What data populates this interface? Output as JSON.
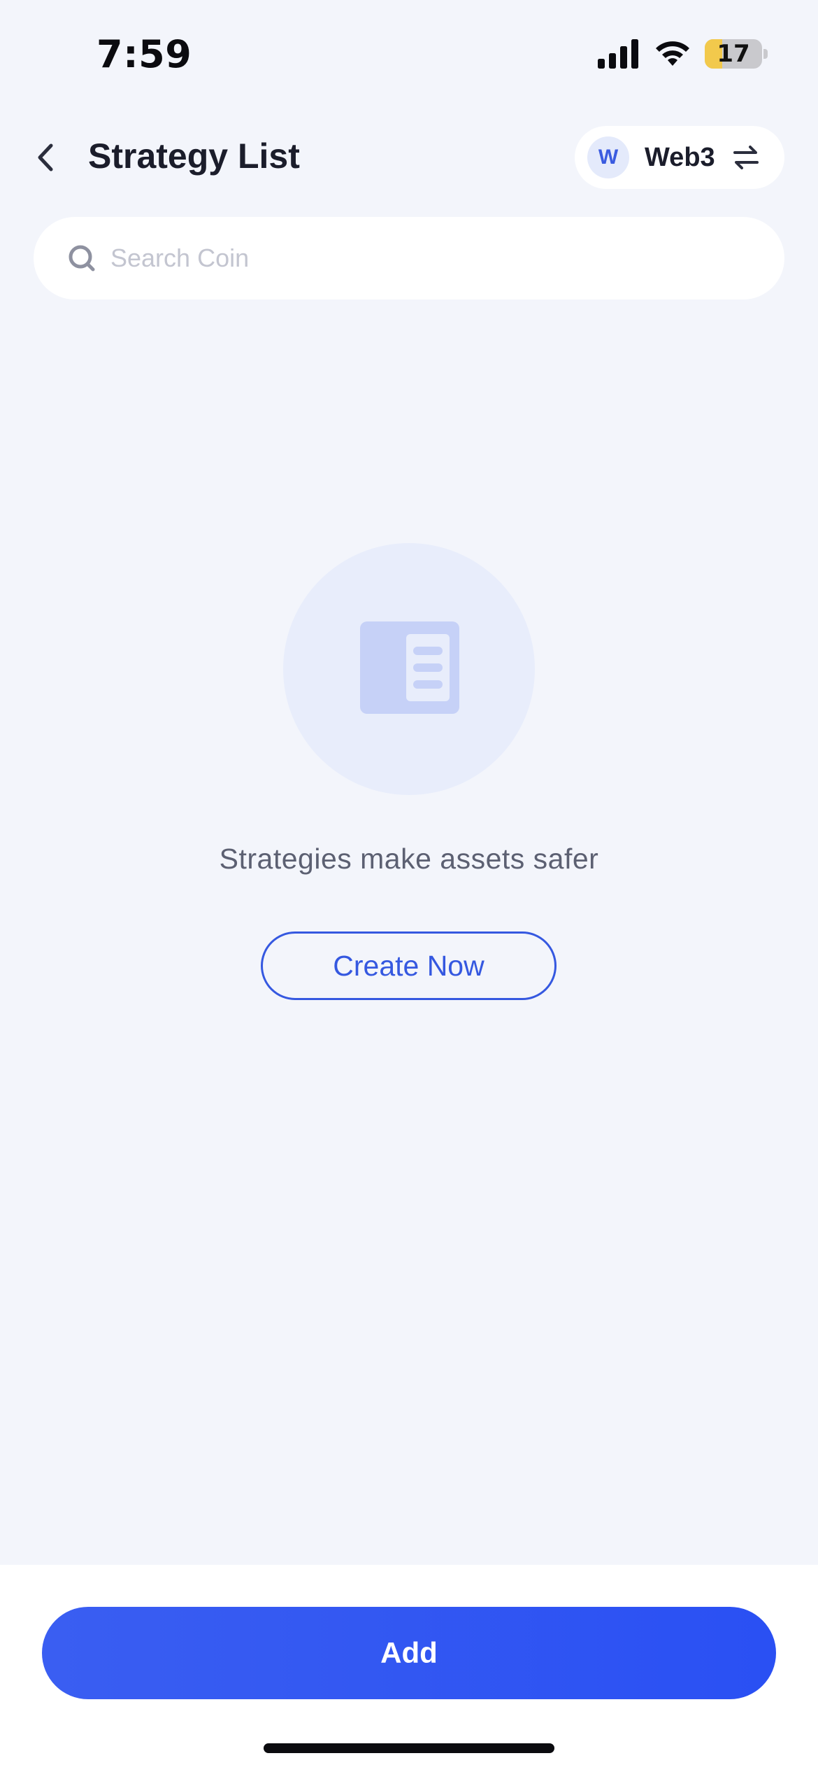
{
  "status_bar": {
    "time": "7:59",
    "battery_level": "17",
    "battery_fraction": 0.17,
    "icons": [
      "signal-icon",
      "wifi-icon",
      "battery-icon"
    ]
  },
  "header": {
    "title": "Strategy List",
    "back_icon": "chevron-left-icon",
    "account": {
      "avatar_letter": "W",
      "name": "Web3",
      "switch_icon": "swap-arrows-icon"
    }
  },
  "search": {
    "placeholder": "Search Coin",
    "value": "",
    "icon": "search-icon"
  },
  "empty_state": {
    "icon": "document-list-icon",
    "message": "Strategies make assets safer",
    "button_label": "Create Now"
  },
  "footer": {
    "add_label": "Add"
  },
  "colors": {
    "background": "#f3f5fb",
    "accent": "#3558e0",
    "primary_button": "#2a50f3",
    "title_text": "#1b1d2b",
    "muted_text": "#5c6072",
    "illustration_bg": "#e8edfb",
    "illustration_fg": "#c6d1f7"
  }
}
